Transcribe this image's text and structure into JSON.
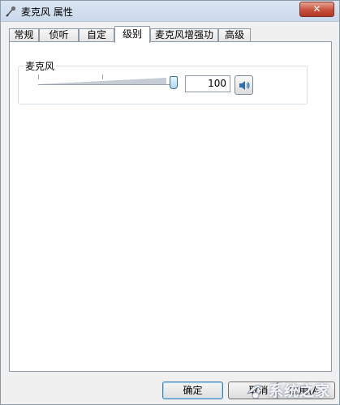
{
  "window": {
    "title": "麦克风 属性",
    "close_label": "✕"
  },
  "tabs": [
    {
      "label": "常规"
    },
    {
      "label": "侦听"
    },
    {
      "label": "自定义"
    },
    {
      "label": "级别"
    },
    {
      "label": "麦克风增强功能"
    },
    {
      "label": "高级"
    }
  ],
  "active_tab": "级别",
  "levels": {
    "group_label": "麦克风",
    "slider_value": 100,
    "value_text": "100",
    "mute_icon": "speaker-icon"
  },
  "footer": {
    "ok_label": "确定",
    "cancel_label": "取消",
    "apply_label": "应用(A)"
  },
  "watermark": {
    "text": "系统之家"
  },
  "colors": {
    "titlebar": "#c9d8ea",
    "close": "#c7503b",
    "thumb": "#a9d8f2"
  }
}
